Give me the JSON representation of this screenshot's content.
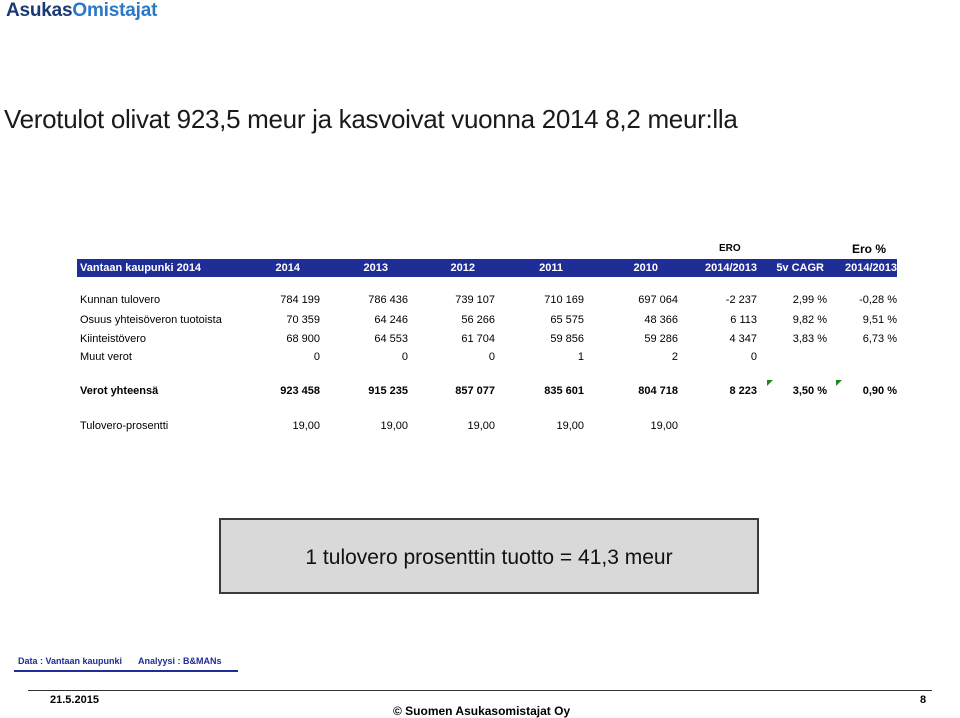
{
  "logo": {
    "part1": "Asukas",
    "part2": "Omistajat"
  },
  "title": "Verotulot olivat 923,5 meur ja kasvoivat vuonna 2014  8,2  meur:lla",
  "table": {
    "over_headers": {
      "ero": "ERO",
      "ero_pct": "Ero %"
    },
    "headers": [
      "Vantaan kaupunki 2014",
      "2014",
      "2013",
      "2012",
      "2011",
      "2010",
      "2014/2013",
      "5v CAGR",
      "2014/2013"
    ],
    "rows": [
      [
        "Kunnan tulovero",
        "784 199",
        "786 436",
        "739 107",
        "710 169",
        "697 064",
        "-2 237",
        "2,99 %",
        "-0,28 %"
      ],
      [
        "Osuus yhteisöveron tuotoista",
        "70 359",
        "64 246",
        "56 266",
        "65 575",
        "48 366",
        "6 113",
        "9,82 %",
        "9,51 %"
      ],
      [
        "Kiinteistövero",
        "68 900",
        "64 553",
        "61 704",
        "59 856",
        "59 286",
        "4 347",
        "3,83 %",
        "6,73 %"
      ],
      [
        "Muut verot",
        "0",
        "0",
        "0",
        "1",
        "2",
        "0",
        "",
        ""
      ]
    ],
    "total": [
      "Verot yhteensä",
      "923 458",
      "915 235",
      "857 077",
      "835 601",
      "804 718",
      "8 223",
      "3,50 %",
      "0,90 %"
    ],
    "rate": [
      "Tulovero-prosentti",
      "19,00",
      "19,00",
      "19,00",
      "19,00",
      "19,00"
    ]
  },
  "callout": "1 tulovero prosenttin tuotto  = 41,3 meur",
  "source": {
    "data": "Data :  Vantaan kaupunki",
    "analysis": "Analyysi : B&MANs"
  },
  "footer": {
    "date": "21.5.2015",
    "copyright": "©  Suomen Asukasomistajat Oy",
    "page": "8"
  }
}
